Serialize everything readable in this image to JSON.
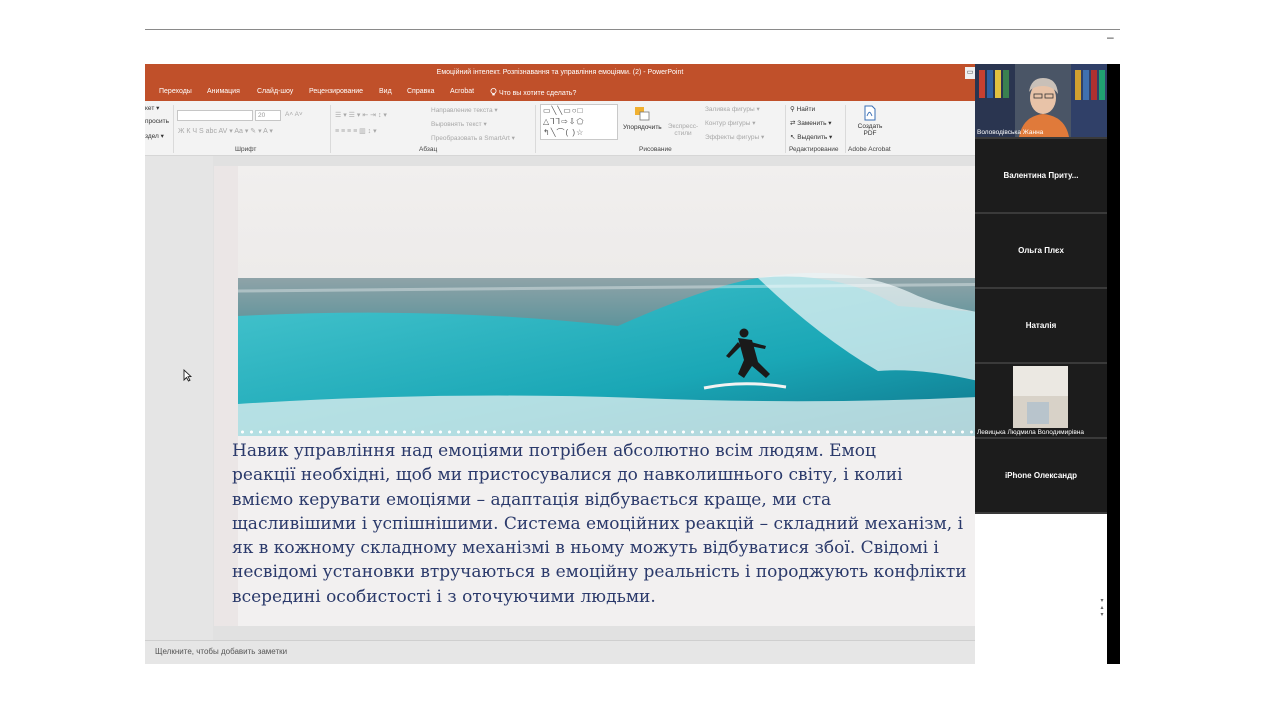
{
  "window": {
    "title": "Емоційний інтелект. Розпізнавання та управління емоціями. (2)  -  PowerPoint",
    "restore_label": "▭"
  },
  "menu": {
    "items": [
      "Переходы",
      "Анимация",
      "Слайд-шоу",
      "Рецензирование",
      "Вид",
      "Справка",
      "Acrobat"
    ],
    "tell_me": "Что вы хотите сделать?"
  },
  "ribbon": {
    "clipboard": [
      "кет ▾",
      "просить",
      "здел ▾"
    ],
    "font_size": "20",
    "font_group_label": "Шрифт",
    "paragraph_group_label": "Абзац",
    "text_direction": "Направление текста ▾",
    "align_text": "Выровнять текст ▾",
    "convert_smartart": "Преобразовать в SmartArt ▾",
    "arrange": "Упорядочить",
    "quick_styles": "Экспресс-стили",
    "shape_fill": "Заливка фигуры ▾",
    "shape_outline": "Контур фигуры ▾",
    "shape_effects": "Эффекты фигуры ▾",
    "drawing_group_label": "Рисование",
    "find": "Найти",
    "replace": "Заменить ▾",
    "select": "Выделить ▾",
    "editing_group_label": "Редактирование",
    "create_pdf": "Создать PDF",
    "acrobat_group_label": "Adobe Acrobat"
  },
  "slide": {
    "body_text": "Навик управління над емоціями потрібен абсолютно всім людям. Емоц\nреакції необхідні, щоб ми пристосувалися до навколишнього світу, і колиі\nвміємо керувати емоціями – адаптація відбувається краще, ми ста\nщасливішими і успішнішими. Система емоційних реакцій – складний механізм, і\nяк в кожному складному механізмі в ньому можуть відбуватися збої. Свідомі і\nнесвідомі установки втручаються в емоційну реальність і породжують конфлікти\nвсередині особистості і з оточуючими людьми."
  },
  "notes": {
    "placeholder": "Щелкните, чтобы добавить заметки"
  },
  "participants": [
    {
      "name": "Воловодівська Жанна",
      "has_video": true
    },
    {
      "name": "Валентина  Приту...",
      "has_video": false
    },
    {
      "name": "Ольга Плєх",
      "has_video": false
    },
    {
      "name": "Наталія",
      "has_video": false
    },
    {
      "name": "Левицька Людмила Володимирівна",
      "has_video": true
    },
    {
      "name": "iPhone Олександр",
      "has_video": false
    }
  ],
  "top": {
    "minimize": "–"
  },
  "colors": {
    "accent": "#c0502a",
    "text": "#2b3a6b"
  }
}
